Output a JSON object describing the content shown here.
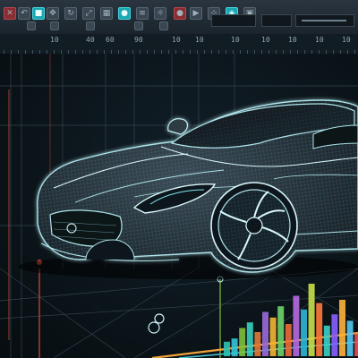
{
  "ruler": {
    "ticks": [
      "10",
      "40",
      "60",
      "90",
      "10",
      "10",
      "10",
      "10",
      "10",
      "10",
      "10"
    ]
  },
  "toolbar": {
    "field_value": "",
    "buttons": [
      "undo-icon",
      "cube-icon",
      "move-icon",
      "rotate-icon",
      "scale-icon",
      "grid-icon",
      "camera-icon",
      "layers-icon",
      "light-icon",
      "record-icon",
      "render-icon",
      "snap-icon",
      "settings-icon",
      "wireframe-icon",
      "mesh-icon",
      "view-icon",
      "more-icon"
    ]
  },
  "colors": {
    "wire": "#aee3ea",
    "accent": "#1aa8b3",
    "red_line": "#d94a3a",
    "green_line": "#7fc23b"
  },
  "bars_chart": {
    "values": [
      0.18,
      0.22,
      0.35,
      0.42,
      0.3,
      0.55,
      0.48,
      0.62,
      0.4,
      0.75,
      0.58,
      0.9,
      0.66,
      0.38,
      0.52,
      0.7,
      0.44,
      0.28
    ],
    "colors": [
      "#2ec4b6",
      "#31c8d8",
      "#7fc23b",
      "#37d0c0",
      "#e07a3a",
      "#9a6bd8",
      "#f2b632",
      "#6ed36a",
      "#ef6a3a",
      "#b66ae0",
      "#2fb6d6",
      "#c9e04a",
      "#ff7a3c",
      "#3ad2c4",
      "#8a60ff",
      "#ffb23a",
      "#56c6ee",
      "#ef4f5a"
    ]
  }
}
